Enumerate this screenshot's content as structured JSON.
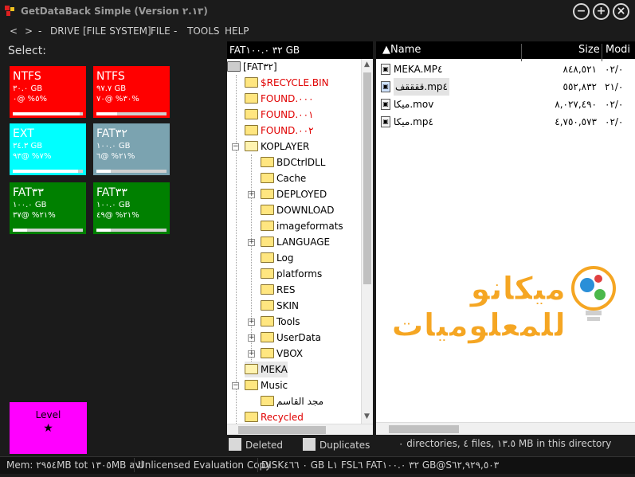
{
  "window": {
    "title": "GetDataBack Simple (Version ٢.١٣)",
    "buttons": [
      "−",
      "+",
      "×"
    ]
  },
  "menu": {
    "back": "<",
    "forward": ">",
    "dash": "-",
    "items": [
      "DRIVE",
      "[FILE SYSTEM]",
      "FILE",
      "TOOLS",
      "HELP"
    ]
  },
  "left": {
    "select_label": "Select:",
    "tiles": [
      {
        "fs": "NTFS",
        "size": "٣٠.٠ GB",
        "pct": "٥% @٠%",
        "color": "#ff0000",
        "fill": 0.95
      },
      {
        "fs": "NTFS",
        "size": "٩٧.٧ GB",
        "pct": "٣٠% @٧٠%",
        "color": "#ff0000",
        "fill": 0.3
      },
      {
        "fs": "EXT",
        "size": "٣٤.٣ GB",
        "pct": "٧% @٩٣%",
        "color": "#00ffff",
        "fill": 0.93
      },
      {
        "fs": "FAT٣٢",
        "size": "١٠٠.٠ GB",
        "pct": "٢١% @٦%",
        "color": "#7ba3b0",
        "fill": 0.21
      },
      {
        "fs": "FAT٣٣",
        "size": "١٠٠.٠ GB",
        "pct": "٢١% @٣٧%",
        "color": "#008000",
        "fill": 0.21
      },
      {
        "fs": "FAT٣٣",
        "size": "١٠٠.٠ GB",
        "pct": "٢١% @٤٩%",
        "color": "#008000",
        "fill": 0.21
      }
    ],
    "level": {
      "label": "Level",
      "star": "★"
    }
  },
  "tree": {
    "header": "FAT٣٢ ١٠٠.٠ GB",
    "nodes": [
      {
        "label": "[FAT٣٢]",
        "depth": 0,
        "red": false,
        "exp": "",
        "open": false,
        "drive": true
      },
      {
        "label": "$RECYCLE.BIN",
        "depth": 1,
        "red": true,
        "exp": "",
        "open": false
      },
      {
        "label": "FOUND.٠٠٠",
        "depth": 1,
        "red": true,
        "exp": "",
        "open": false
      },
      {
        "label": "FOUND.٠٠١",
        "depth": 1,
        "red": true,
        "exp": "",
        "open": false
      },
      {
        "label": "FOUND.٠٠٢",
        "depth": 1,
        "red": true,
        "exp": "",
        "open": false
      },
      {
        "label": "KOPLAYER",
        "depth": 1,
        "red": false,
        "exp": "−",
        "open": true
      },
      {
        "label": "BDCtrlDLL",
        "depth": 2,
        "red": false,
        "exp": "",
        "open": false
      },
      {
        "label": "Cache",
        "depth": 2,
        "red": false,
        "exp": "",
        "open": false
      },
      {
        "label": "DEPLOYED",
        "depth": 2,
        "red": false,
        "exp": "+",
        "open": false
      },
      {
        "label": "DOWNLOAD",
        "depth": 2,
        "red": false,
        "exp": "",
        "open": false
      },
      {
        "label": "imageformats",
        "depth": 2,
        "red": false,
        "exp": "",
        "open": false
      },
      {
        "label": "LANGUAGE",
        "depth": 2,
        "red": false,
        "exp": "+",
        "open": false
      },
      {
        "label": "Log",
        "depth": 2,
        "red": false,
        "exp": "",
        "open": false
      },
      {
        "label": "platforms",
        "depth": 2,
        "red": false,
        "exp": "",
        "open": false
      },
      {
        "label": "RES",
        "depth": 2,
        "red": false,
        "exp": "",
        "open": false
      },
      {
        "label": "SKIN",
        "depth": 2,
        "red": false,
        "exp": "",
        "open": false
      },
      {
        "label": "Tools",
        "depth": 2,
        "red": false,
        "exp": "+",
        "open": false
      },
      {
        "label": "UserData",
        "depth": 2,
        "red": false,
        "exp": "+",
        "open": false
      },
      {
        "label": "VBOX",
        "depth": 2,
        "red": false,
        "exp": "+",
        "open": false
      },
      {
        "label": "MEKA",
        "depth": 1,
        "red": false,
        "exp": "",
        "open": true,
        "selected": true
      },
      {
        "label": "Music",
        "depth": 1,
        "red": false,
        "exp": "−",
        "open": false
      },
      {
        "label": "مجد القاسم",
        "depth": 2,
        "red": false,
        "exp": "",
        "open": false
      },
      {
        "label": "Recycled",
        "depth": 1,
        "red": true,
        "exp": "",
        "open": false
      }
    ]
  },
  "files": {
    "columns": {
      "name": "▲Name",
      "size": "Size",
      "modified": "Modi"
    },
    "rows": [
      {
        "name": "MEKA.MP٤",
        "size": "٨٤٨,٥٢١",
        "mod": "٠٢/٠",
        "selected": false
      },
      {
        "name": "ققققف.mp٤",
        "size": "٥٥٢,٨٣٢",
        "mod": "٢١/٠",
        "selected": true
      },
      {
        "name": "ميكا.mov",
        "size": "٨,٠٢٧,٤٩٠",
        "mod": "٠٢/٠",
        "selected": false
      },
      {
        "name": "ميكا.mp٤",
        "size": "٤,٧٥٠,٥٧٣",
        "mod": "٠٢/٠",
        "selected": false
      }
    ]
  },
  "watermark": {
    "text": "ميكانو للمعلوميات"
  },
  "legend": {
    "deleted": "Deleted",
    "duplicates": "Duplicates",
    "summary": "٠ directories, ٤ files, ١٣.٥ MB in this directory"
  },
  "status": {
    "mem": "Mem: ٢٩٥٤MB tot ١٣٠٥MB avl",
    "license": "Unlicensed Evaluation Copy",
    "disk": "DISK٠ ٤٦٦ GB L١ FSL٦ FAT٣٢ ١٠٠.٠ GB@S٦٢,٩٢٩,٥٠٣"
  }
}
